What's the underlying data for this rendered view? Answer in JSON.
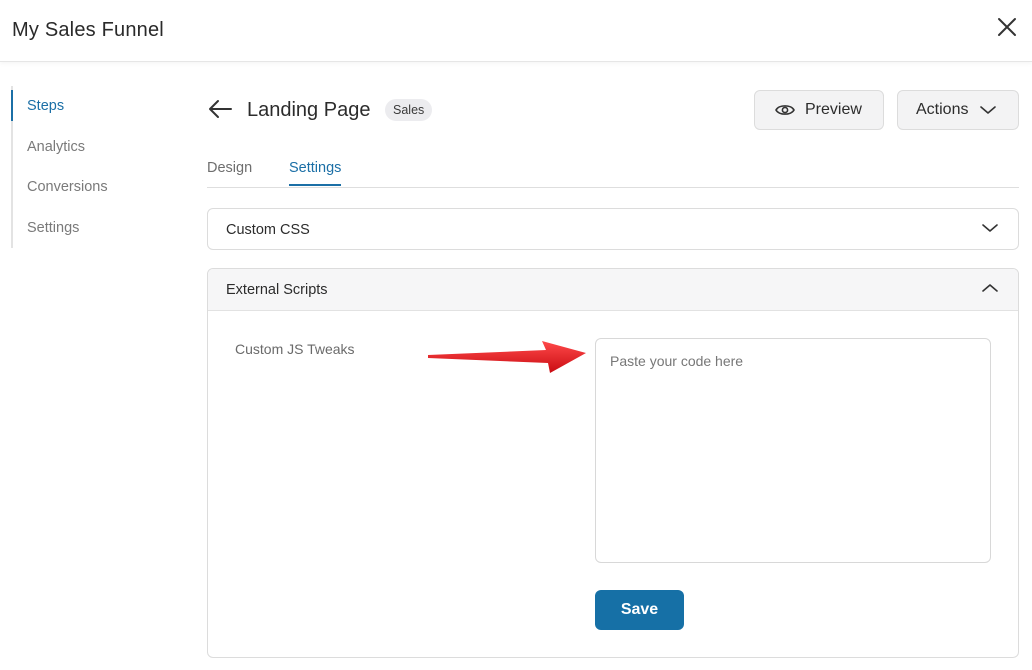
{
  "app": {
    "title": "My Sales Funnel"
  },
  "sidebar": {
    "items": [
      {
        "label": "Steps",
        "active": true
      },
      {
        "label": "Analytics",
        "active": false
      },
      {
        "label": "Conversions",
        "active": false
      },
      {
        "label": "Settings",
        "active": false
      }
    ]
  },
  "header": {
    "title": "Landing Page",
    "badge": "Sales",
    "preview_label": "Preview",
    "actions_label": "Actions"
  },
  "tabs": [
    {
      "label": "Design",
      "active": false
    },
    {
      "label": "Settings",
      "active": true
    }
  ],
  "sections": {
    "custom_css": {
      "title": "Custom CSS",
      "expanded": false
    },
    "external_scripts": {
      "title": "External Scripts",
      "expanded": true,
      "field_label": "Custom JS Tweaks",
      "code_value": "",
      "code_placeholder": "Paste your code here",
      "save_label": "Save"
    }
  },
  "colors": {
    "accent": "#1b6fa6",
    "primary_button": "#1670a6",
    "annotation_arrow": "#e8141b"
  },
  "icons": {
    "close": "close-icon",
    "back": "arrow-left-icon",
    "preview": "eye-icon",
    "actions": "chevron-down-icon",
    "collapsed": "chevron-down-icon",
    "expanded": "chevron-up-icon"
  }
}
